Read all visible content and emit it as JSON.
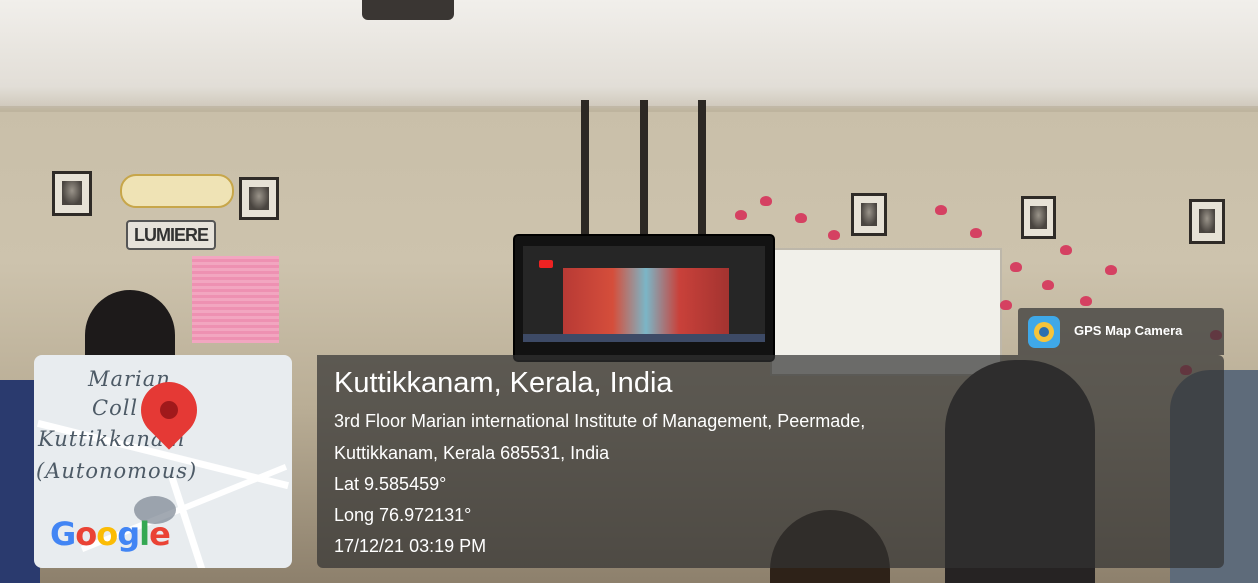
{
  "scene": {
    "wall_banner": "LUMIERE"
  },
  "overlay": {
    "app_badge": "GPS Map Camera",
    "map": {
      "label_lines": [
        "Marian",
        "Coll",
        "Kuttikkanam",
        "(Autonomous)"
      ],
      "brand_letters": [
        "G",
        "o",
        "o",
        "g",
        "l",
        "e"
      ]
    },
    "location": {
      "title": "Kuttikkanam, Kerala, India",
      "address_line1": "3rd Floor Marian international Institute of Management, Peermade,",
      "address_line2": "Kuttikkanam, Kerala 685531, India",
      "latitude": "Lat 9.585459°",
      "longitude": "Long 76.972131°",
      "timestamp": "17/12/21 03:19 PM"
    },
    "colors": {
      "pin": "#e53935",
      "panel": "#323232"
    }
  }
}
